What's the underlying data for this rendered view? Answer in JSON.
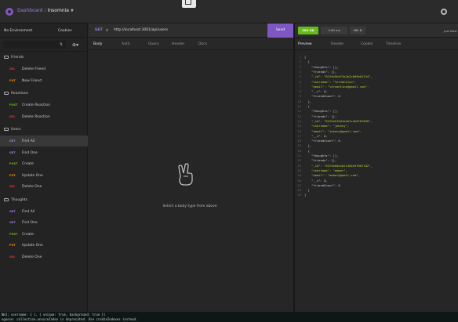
{
  "header": {
    "dashboard": "Dashboard",
    "sep": "/",
    "project": "Insomnia"
  },
  "sidebar": {
    "environment": "No Environment",
    "cookies": "Cookies",
    "groups": [
      {
        "label": "Friends",
        "items": [
          {
            "method": "DEL",
            "label": "Delete Friend"
          },
          {
            "method": "PUT",
            "label": "New Friend"
          }
        ]
      },
      {
        "label": "Reactions",
        "items": [
          {
            "method": "POST",
            "label": "Create Reaction"
          },
          {
            "method": "DEL",
            "label": "Delete Reaction"
          }
        ]
      },
      {
        "label": "Users",
        "items": [
          {
            "method": "GET",
            "label": "Find All"
          },
          {
            "method": "GET",
            "label": "Find One"
          },
          {
            "method": "POST",
            "label": "Create"
          },
          {
            "method": "PUT",
            "label": "Update One"
          },
          {
            "method": "DEL",
            "label": "Delete One"
          }
        ]
      },
      {
        "label": "Thoughts",
        "items": [
          {
            "method": "GET",
            "label": "Find All"
          },
          {
            "method": "GET",
            "label": "Find One"
          },
          {
            "method": "POST",
            "label": "Create"
          },
          {
            "method": "PUT",
            "label": "Update One"
          },
          {
            "method": "DEL",
            "label": "Delete One"
          }
        ]
      }
    ]
  },
  "request": {
    "method": "GET",
    "url": "http://localhost:3001/api/users",
    "send": "Send",
    "tabs": [
      "Body",
      "Auth",
      "Query",
      "Header",
      "Docs"
    ],
    "empty": "Select a body type from above"
  },
  "response": {
    "status": "200 OK",
    "time": "2.63 ms",
    "size": "584 B",
    "just_now": "Just Now",
    "tabs": [
      "Preview",
      "Header",
      "Cookie",
      "Timeline"
    ],
    "lines": [
      "[",
      "  {",
      "    \"thoughts\": [],",
      "    \"friends\": [],",
      "    \"_id\": \"62f4e5e4f3a1b2c8d9e01234\",",
      "    \"username\": \"lernantino\",",
      "    \"email\": \"lernantino@gmail.com\",",
      "    \"__v\": 0,",
      "    \"friendCount\": 0",
      "  },",
      "  {",
      "    \"thoughts\": [],",
      "    \"friends\": [],",
      "    \"_id\": \"62f4e5f0d1a2b3c4e5f67890\",",
      "    \"username\": \"johnny\",",
      "    \"email\": \"johnny@gmail.com\",",
      "    \"__v\": 0,",
      "    \"friendCount\": 0",
      "  },",
      "  {",
      "    \"thoughts\": [],",
      "    \"friends\": [],",
      "    \"_id\": \"62f4e60a1b2c3d4e5f607182\",",
      "    \"username\": \"amber\",",
      "    \"email\": \"amber@gmail.com\",",
      "    \"__v\": 0,",
      "    \"friendCount\": 0",
      "  }",
      "]"
    ]
  },
  "terminal": {
    "line1": "Nm1; username: 1 }, { unique: true, background: true })",
    "line2": "ngoose: collection.ensureIndex is deprecated. Use createIndexes instead."
  }
}
